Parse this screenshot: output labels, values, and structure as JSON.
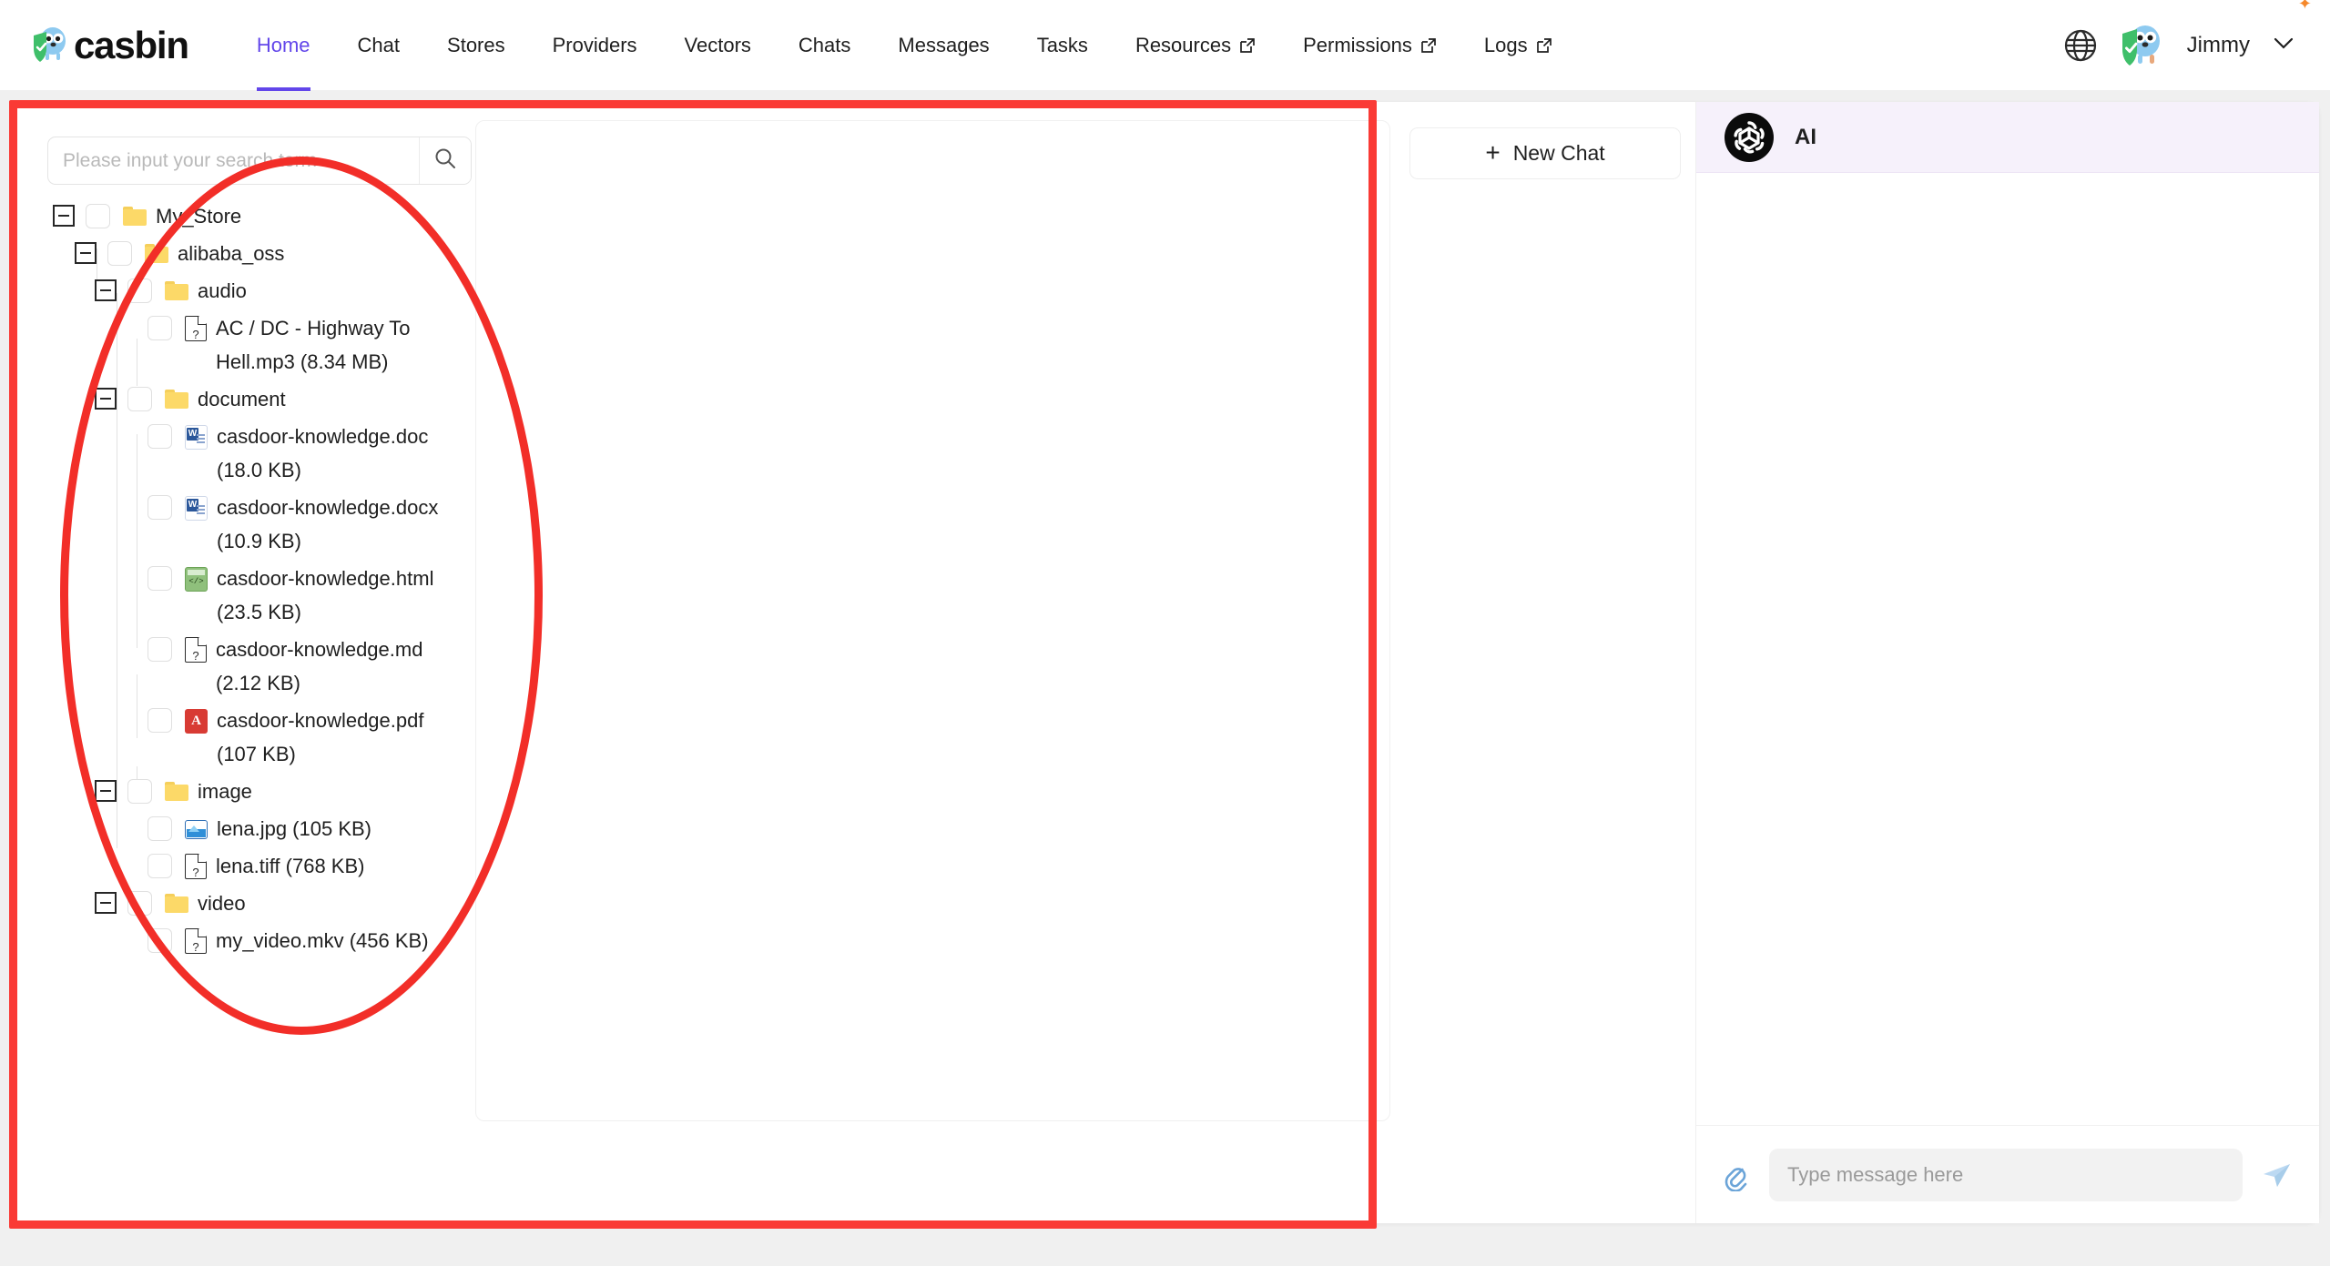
{
  "brand": {
    "name": "casbin"
  },
  "nav": {
    "items": [
      {
        "label": "Home",
        "external": false,
        "active": true
      },
      {
        "label": "Chat",
        "external": false,
        "active": false
      },
      {
        "label": "Stores",
        "external": false,
        "active": false
      },
      {
        "label": "Providers",
        "external": false,
        "active": false
      },
      {
        "label": "Vectors",
        "external": false,
        "active": false
      },
      {
        "label": "Chats",
        "external": false,
        "active": false
      },
      {
        "label": "Messages",
        "external": false,
        "active": false
      },
      {
        "label": "Tasks",
        "external": false,
        "active": false
      },
      {
        "label": "Resources",
        "external": true,
        "active": false
      },
      {
        "label": "Permissions",
        "external": true,
        "active": false
      },
      {
        "label": "Logs",
        "external": true,
        "active": false
      }
    ]
  },
  "header_right": {
    "language_icon": "globe-icon",
    "avatar_icon": "gopher-avatar",
    "user_name": "Jimmy",
    "chevron": "⌄"
  },
  "search": {
    "placeholder": "Please input your search term",
    "value": "",
    "button_icon": "search-icon"
  },
  "tree": {
    "nodes": [
      {
        "label": "My_Store",
        "size": "",
        "depth": 0,
        "type": "folder",
        "expanded": true,
        "icon": "folder-icon"
      },
      {
        "label": "alibaba_oss",
        "size": "",
        "depth": 1,
        "type": "folder",
        "expanded": true,
        "icon": "folder-icon"
      },
      {
        "label": "audio",
        "size": "",
        "depth": 2,
        "type": "folder",
        "expanded": true,
        "icon": "folder-icon"
      },
      {
        "label": "AC / DC - Highway To Hell.mp3 (8.34 MB)",
        "size": "8.34 MB",
        "depth": 3,
        "type": "file",
        "expanded": false,
        "icon": "generic-file-icon"
      },
      {
        "label": "document",
        "size": "",
        "depth": 2,
        "type": "folder",
        "expanded": true,
        "icon": "folder-icon"
      },
      {
        "label": "casdoor-knowledge.doc (18.0 KB)",
        "size": "18.0 KB",
        "depth": 3,
        "type": "file",
        "expanded": false,
        "icon": "word-file-icon"
      },
      {
        "label": "casdoor-knowledge.docx (10.9 KB)",
        "size": "10.9 KB",
        "depth": 3,
        "type": "file",
        "expanded": false,
        "icon": "word-file-icon"
      },
      {
        "label": "casdoor-knowledge.html (23.5 KB)",
        "size": "23.5 KB",
        "depth": 3,
        "type": "file",
        "expanded": false,
        "icon": "html-file-icon"
      },
      {
        "label": "casdoor-knowledge.md (2.12 KB)",
        "size": "2.12 KB",
        "depth": 3,
        "type": "file",
        "expanded": false,
        "icon": "generic-file-icon"
      },
      {
        "label": "casdoor-knowledge.pdf (107 KB)",
        "size": "107 KB",
        "depth": 3,
        "type": "file",
        "expanded": false,
        "icon": "pdf-file-icon"
      },
      {
        "label": "image",
        "size": "",
        "depth": 2,
        "type": "folder",
        "expanded": true,
        "icon": "folder-icon"
      },
      {
        "label": "lena.jpg (105 KB)",
        "size": "105 KB",
        "depth": 3,
        "type": "file",
        "expanded": false,
        "icon": "image-file-icon"
      },
      {
        "label": "lena.tiff (768 KB)",
        "size": "768 KB",
        "depth": 3,
        "type": "file",
        "expanded": false,
        "icon": "generic-file-icon"
      },
      {
        "label": "video",
        "size": "",
        "depth": 2,
        "type": "folder",
        "expanded": true,
        "icon": "folder-icon"
      },
      {
        "label": "my_video.mkv (456 KB)",
        "size": "456 KB",
        "depth": 3,
        "type": "file",
        "expanded": false,
        "icon": "generic-file-icon"
      }
    ]
  },
  "chat_list": {
    "new_chat_label": "New Chat",
    "plus_icon": "plus-icon"
  },
  "chat": {
    "ai_name": "AI",
    "ai_icon": "openai-logo-icon",
    "attach_icon": "paperclip-icon",
    "send_icon": "send-icon",
    "input_placeholder": "Type message here",
    "input_value": ""
  },
  "annotations": {
    "rect_color": "#fa3a35",
    "ellipse_color": "#f22e28"
  }
}
